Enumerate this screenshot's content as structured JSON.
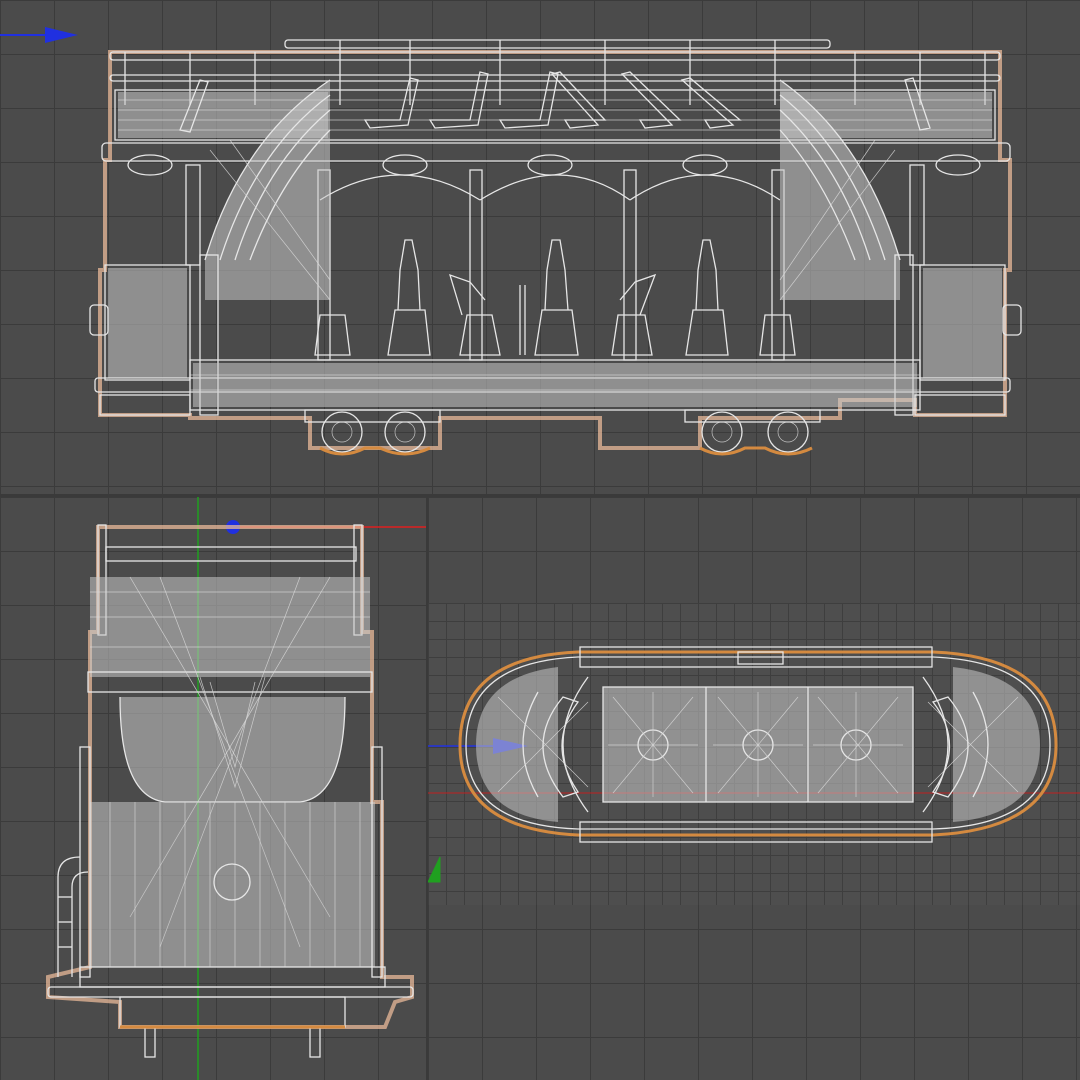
{
  "viewports": [
    {
      "id": "front",
      "view": "front",
      "axes": [
        "x-axis-arrow"
      ]
    },
    {
      "id": "side",
      "view": "side",
      "axes": [
        "x-axis-arrow",
        "y-axis-line",
        "origin-point"
      ]
    },
    {
      "id": "top",
      "view": "top",
      "axes": [
        "x-axis-arrow",
        "y-axis-arrow"
      ]
    }
  ],
  "colors": {
    "background": "#4b4b4b",
    "grid_line": "#3b3b3b",
    "wireframe": "#e6e6e6",
    "selection_outline": "#e8b898",
    "selection_outline_strong": "#d48a40",
    "axis_x": "#e02020",
    "axis_y": "#20a020",
    "axis_z": "#2030e0"
  },
  "model": {
    "seat_count_upper": 7,
    "seat_count_lower": 7,
    "wheel_count_per_bogie": 2,
    "bogie_count": 2
  }
}
